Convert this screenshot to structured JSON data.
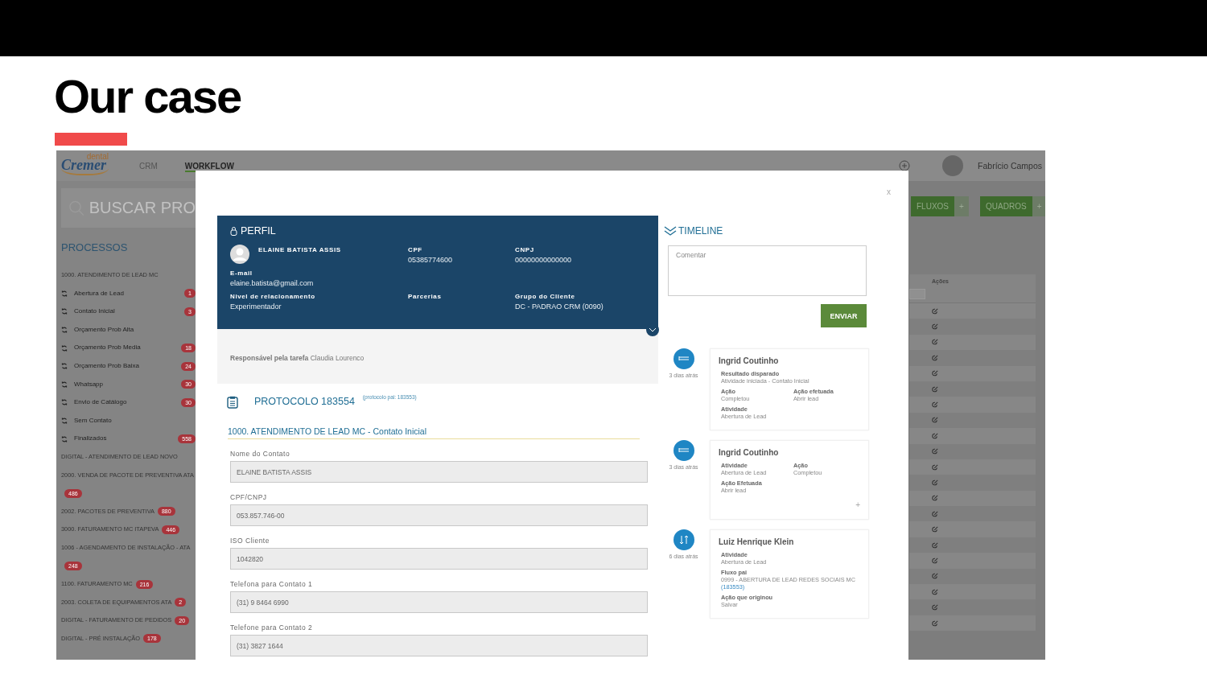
{
  "slide": {
    "title": "Our case"
  },
  "app": {
    "logo": {
      "tag": "dental",
      "name": "Cremer"
    },
    "nav": [
      {
        "label": "CRM",
        "selected": false
      },
      {
        "label": "WORKFLOW",
        "selected": true
      }
    ],
    "user": {
      "name": "Fabrício Campos"
    },
    "search": {
      "placeholder": "BUSCAR PRO"
    },
    "sidebar": {
      "title": "PROCESSOS",
      "items": [
        {
          "kind": "group",
          "label": "1000. ATENDIMENTO DE LEAD MC"
        },
        {
          "kind": "step",
          "label": "Abertura de Lead",
          "badge": "1"
        },
        {
          "kind": "step",
          "label": "Contato Inicial",
          "badge": "3"
        },
        {
          "kind": "step",
          "label": "Orçamento Prob Alta"
        },
        {
          "kind": "step",
          "label": "Orçamento Prob Media",
          "badge": "18"
        },
        {
          "kind": "step",
          "label": "Orçamento Prob Baixa",
          "badge": "24"
        },
        {
          "kind": "step",
          "label": "Whatsapp",
          "badge": "30"
        },
        {
          "kind": "step",
          "label": "Envio de Catálogo",
          "badge": "30"
        },
        {
          "kind": "step",
          "label": "Sem Contato"
        },
        {
          "kind": "step",
          "label": "Finalizados",
          "badge": "558"
        },
        {
          "kind": "group",
          "label": "DIGITAL - ATENDIMENTO DE LEAD NOVO"
        },
        {
          "kind": "group",
          "label": "2000. VENDA DE PACOTE DE PREVENTIVA ATA",
          "badge": "486"
        },
        {
          "kind": "group",
          "label": "2002. PACOTES DE PREVENTIVA",
          "badge": "880"
        },
        {
          "kind": "group",
          "label": "3000. FATURAMENTO MC ITAPEVA",
          "badge": "446"
        },
        {
          "kind": "group",
          "label": "1006 - AGENDAMENTO DE INSTALAÇÃO - ATA",
          "badge": "248"
        },
        {
          "kind": "group",
          "label": "1100. FATURAMENTO MC",
          "badge": "216"
        },
        {
          "kind": "group",
          "label": "2003. COLETA DE EQUIPAMENTOS ATA",
          "badge": "2"
        },
        {
          "kind": "group",
          "label": "DIGITAL - FATURAMENTO DE PEDIDOS",
          "badge": "20"
        },
        {
          "kind": "group",
          "label": "DIGITAL - PRÉ INSTALAÇÃO",
          "badge": "178"
        }
      ]
    },
    "toolbar": [
      {
        "label": "FLUXOS",
        "add": "+"
      },
      {
        "label": "QUADROS",
        "add": "+"
      }
    ],
    "table": {
      "columns": [
        "Ações"
      ]
    }
  },
  "modal": {
    "close": "x",
    "profile": {
      "title": "PERFIL",
      "rows": [
        [
          {
            "kind": "person",
            "value": "ELAINE BATISTA ASSIS"
          },
          {
            "kind": "field",
            "label": "CPF",
            "value": "05385774600"
          },
          {
            "kind": "field",
            "label": "CNPJ",
            "value": "00000000000000"
          }
        ],
        [
          {
            "kind": "field",
            "label": "E-mail",
            "value": "elaine.batista@gmail.com"
          }
        ],
        [
          {
            "kind": "field",
            "label": "Nivel de relacionamento",
            "value": "Experimentador"
          },
          {
            "kind": "field",
            "label": "Parcerias"
          },
          {
            "kind": "field",
            "label": "Grupo do Cliente",
            "value": "DC - PADRAO CRM (0090)"
          }
        ]
      ]
    },
    "responsible": {
      "label": "Responsável pela tarefa",
      "value": "Claudia Lourenco"
    },
    "protocol": {
      "title": "PROTOCOLO 183554",
      "parent": "(protocolo pai: 183553)"
    },
    "section": "1000. ATENDIMENTO DE LEAD MC - Contato Inicial",
    "fields": [
      {
        "label": "Nome do Contato",
        "value": "ELAINE BATISTA ASSIS"
      },
      {
        "label": "CPF/CNPJ",
        "value": "053.857.746-00"
      },
      {
        "label": "ISO Cliente",
        "value": "1042820"
      },
      {
        "label": "Telefona para Contato 1",
        "value": "(31) 9 8464 6990"
      },
      {
        "label": "Telefone para Contato 2",
        "value": "(31) 3827 1644"
      }
    ],
    "timeline": {
      "title": "TIMELINE",
      "comment": {
        "placeholder": "Comentar"
      },
      "send": "ENVIAR",
      "entries": [
        {
          "kind": "list",
          "time": "3 dias atrás",
          "author": "Ingrid Coutinho",
          "rows": [
            [
              {
                "label": "Resultado disparado",
                "value": "Atividade iniciada - Contato Inicial"
              }
            ],
            [
              {
                "label": "Ação",
                "value": "Completou"
              },
              {
                "label": "Ação efetuada",
                "value": "Abrir lead"
              }
            ],
            [
              {
                "label": "Atividade",
                "value": "Abertura de Lead"
              }
            ]
          ]
        },
        {
          "kind": "list",
          "time": "3 dias atrás",
          "author": "Ingrid Coutinho",
          "more": "+",
          "rows": [
            [
              {
                "label": "Atividade",
                "value": "Abertura de Lead"
              },
              {
                "label": "Ação",
                "value": "Completou"
              }
            ],
            [
              {
                "label": "Ação Efetuada",
                "value": "Abrir lead"
              }
            ]
          ]
        },
        {
          "kind": "transfer",
          "time": "6 dias atrás",
          "author": "Luiz Henrique Klein",
          "rows": [
            [
              {
                "label": "Atividade",
                "value": "Abertura de Lead"
              }
            ],
            [
              {
                "label": "Fluxo pai",
                "value": "0999 - ABERTURA DE LEAD REDES SOCIAIS MC",
                "link": "(183553)"
              }
            ],
            [
              {
                "label": "Ação que originou",
                "value": "Salvar"
              }
            ]
          ]
        }
      ]
    }
  }
}
